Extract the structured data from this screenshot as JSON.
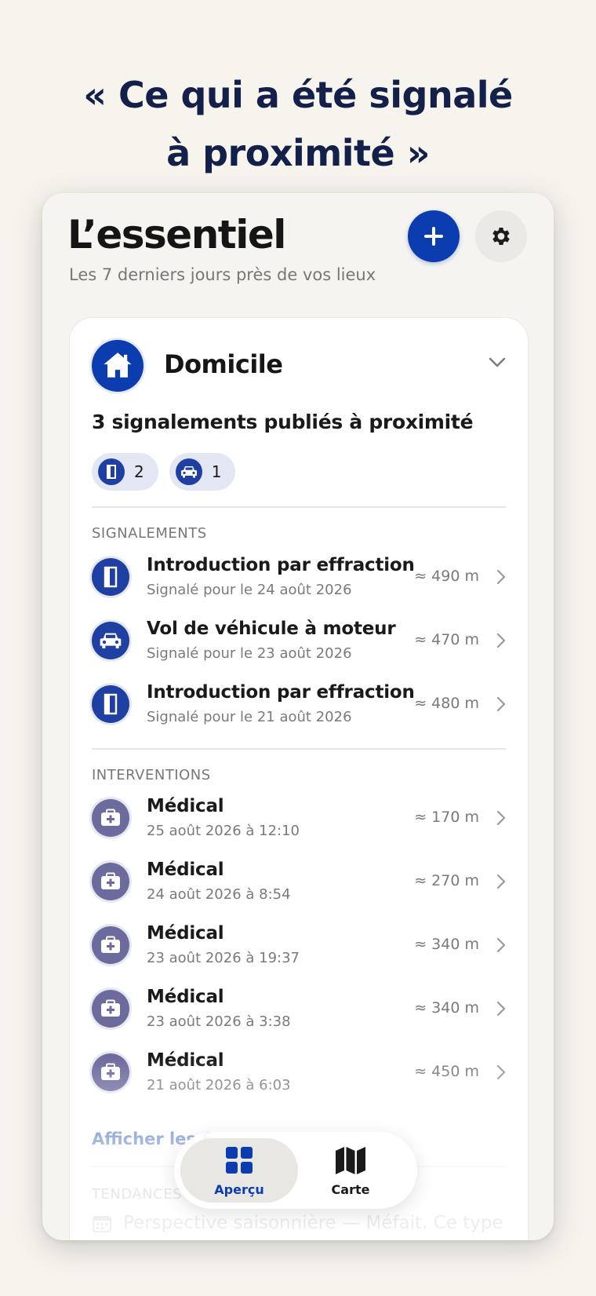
{
  "headline": {
    "line1": "« Ce qui a été signalé",
    "line2": "à proximité »"
  },
  "header": {
    "title": "L’essentiel",
    "subtitle": "Les 7 derniers jours près de vos lieux",
    "add_icon": "plus-icon",
    "settings_icon": "gear-icon"
  },
  "place": {
    "name": "Domicile",
    "icon": "house-icon",
    "summary": "3 signalements publiés à proximité",
    "chips": [
      {
        "icon": "door-icon",
        "count": "2"
      },
      {
        "icon": "car-icon",
        "count": "1"
      }
    ]
  },
  "signalements": {
    "label": "SIGNALEMENTS",
    "items": [
      {
        "icon": "door-icon",
        "title": "Introduction par effraction",
        "subtitle": "Signalé pour le 24 août 2026",
        "distance": "≈ 490 m"
      },
      {
        "icon": "car-icon",
        "title": "Vol de véhicule à moteur",
        "subtitle": "Signalé pour le 23 août 2026",
        "distance": "≈ 470 m"
      },
      {
        "icon": "door-icon",
        "title": "Introduction par effraction",
        "subtitle": "Signalé pour le 21 août 2026",
        "distance": "≈ 480 m"
      }
    ]
  },
  "interventions": {
    "label": "INTERVENTIONS",
    "items": [
      {
        "icon": "medical-kit-icon",
        "title": "Médical",
        "subtitle": "25 août 2026 à 12:10",
        "distance": "≈ 170 m"
      },
      {
        "icon": "medical-kit-icon",
        "title": "Médical",
        "subtitle": "24 août 2026 à 8:54",
        "distance": "≈ 270 m"
      },
      {
        "icon": "medical-kit-icon",
        "title": "Médical",
        "subtitle": "23 août 2026 à 19:37",
        "distance": "≈ 340 m"
      },
      {
        "icon": "medical-kit-icon",
        "title": "Médical",
        "subtitle": "23 août 2026 à 3:38",
        "distance": "≈ 340 m"
      },
      {
        "icon": "medical-kit-icon",
        "title": "Médical",
        "subtitle": "21 août 2026 à 6:03",
        "distance": "≈ 450 m"
      }
    ]
  },
  "show_more": "Afficher les 6",
  "trends": {
    "label": "TENDANCES",
    "line": "Perspective saisonnière — Méfait. Ce type"
  },
  "tabbar": {
    "tabs": [
      {
        "label": "Aperçu",
        "icon": "grid-icon",
        "active": true
      },
      {
        "label": "Carte",
        "icon": "map-icon",
        "active": false
      }
    ]
  },
  "colors": {
    "accent": "#0b3db0",
    "background": "#f7f4ee",
    "headline": "#12204a",
    "link": "#2e5fb6"
  }
}
